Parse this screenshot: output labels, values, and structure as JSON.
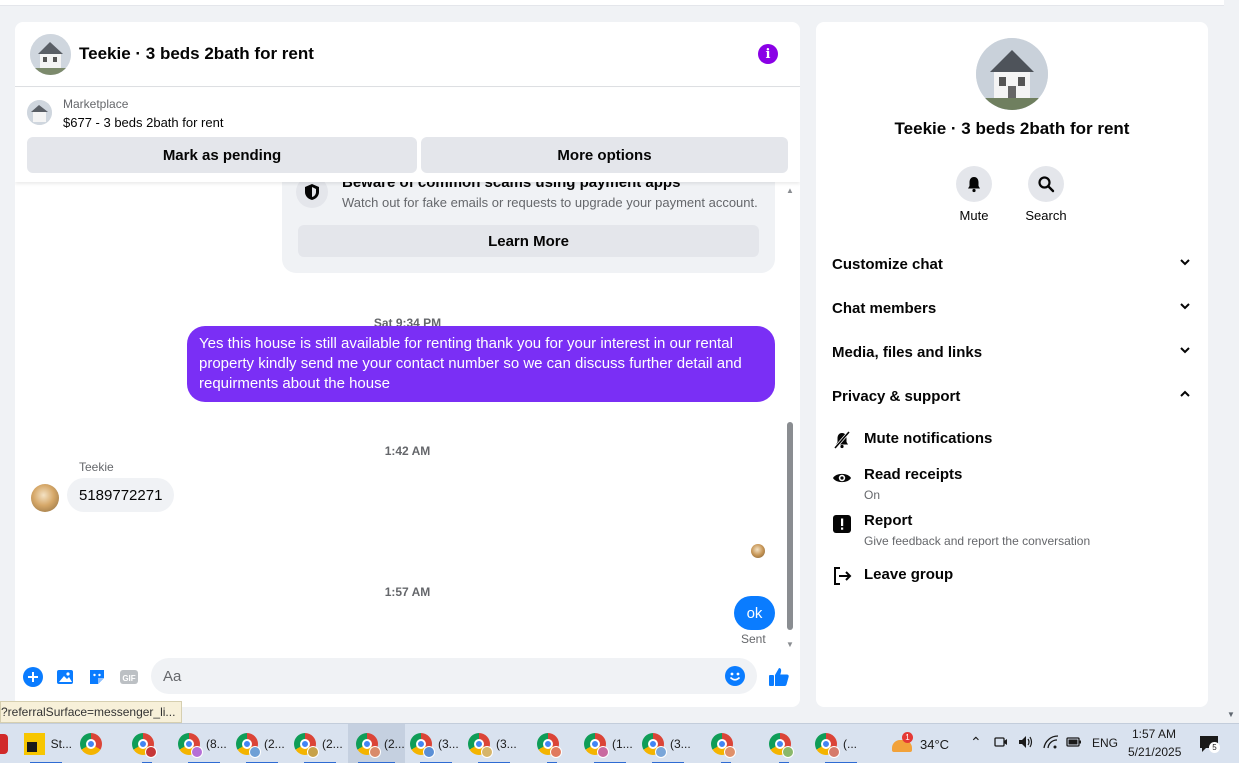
{
  "chat": {
    "title": "Teekie · 3 beds 2bath for rent",
    "listing": {
      "kind": "Marketplace",
      "description": "$677 - 3 beds 2bath for rent",
      "mark_pending": "Mark as pending",
      "more_options": "More options"
    },
    "scam_notice": {
      "title": "Beware of common scams using payment apps",
      "subtitle": "Watch out for fake emails or requests to upgrade your payment account.",
      "button": "Learn More"
    },
    "messages": [
      {
        "timestamp": "Sat 9:34 PM",
        "from": "me",
        "text": "Yes this house is still available for renting thank you for your interest in our rental property kindly send me your contact number so we can discuss further detail and requirments about the house"
      },
      {
        "timestamp": "1:42 AM",
        "from": "Teekie",
        "text": "5189772271"
      },
      {
        "timestamp": "1:57 AM",
        "from": "me",
        "text": "ok",
        "status": "Sent"
      }
    ],
    "composer": {
      "placeholder": "Aa"
    }
  },
  "status_url": "?referralSurface=messenger_li...",
  "info_panel": {
    "title": "Teekie · 3 beds 2bath for rent",
    "actions": [
      {
        "label": "Mute",
        "icon": "bell-icon"
      },
      {
        "label": "Search",
        "icon": "search-icon"
      }
    ],
    "sections": [
      {
        "label": "Customize chat",
        "expanded": false
      },
      {
        "label": "Chat members",
        "expanded": false
      },
      {
        "label": "Media, files and links",
        "expanded": false
      },
      {
        "label": "Privacy & support",
        "expanded": true
      }
    ],
    "privacy_items": [
      {
        "label": "Mute notifications",
        "desc": "",
        "icon": "bell-off-icon"
      },
      {
        "label": "Read receipts",
        "desc": "On",
        "icon": "eye-icon"
      },
      {
        "label": "Report",
        "desc": "Give feedback and report the conversation",
        "icon": "alert-icon"
      },
      {
        "label": "Leave group",
        "desc": "",
        "icon": "leave-icon"
      }
    ]
  },
  "taskbar": {
    "items": [
      {
        "label": "St..."
      },
      {
        "label": ""
      },
      {
        "label": ""
      },
      {
        "label": "(8..."
      },
      {
        "label": "(2..."
      },
      {
        "label": "(2..."
      },
      {
        "label": "(2..."
      },
      {
        "label": "(3..."
      },
      {
        "label": "(3..."
      },
      {
        "label": ""
      },
      {
        "label": "(1..."
      },
      {
        "label": "(3..."
      },
      {
        "label": ""
      },
      {
        "label": ""
      },
      {
        "label": "(..."
      }
    ],
    "weather_badge": "1",
    "temperature": "34°C",
    "language": "ENG",
    "time": "1:57 AM",
    "date": "5/21/2025",
    "notification_count": "5"
  },
  "colors": {
    "accent_purple": "#7a2ff5",
    "messenger_blue": "#0a7cff",
    "info_purple": "#8a00e6"
  }
}
